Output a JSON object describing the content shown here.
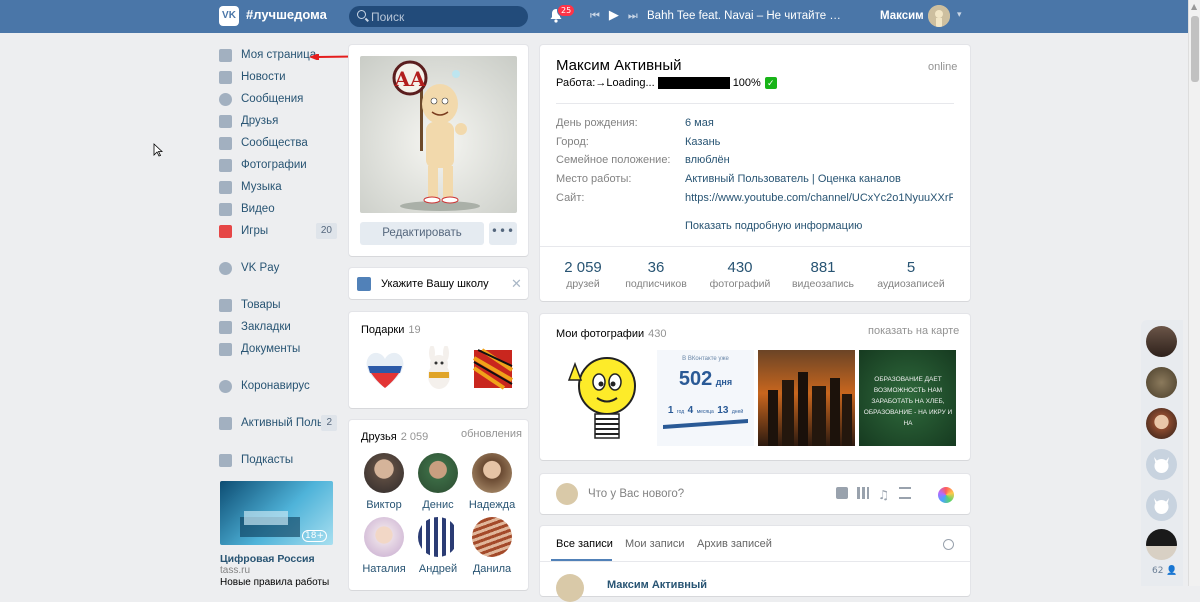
{
  "topbar": {
    "logo": "VK",
    "hashtag": "#лучшедома",
    "search_placeholder": "Поиск",
    "notif_count": "25",
    "track": "Bahh Tee feat. Navai – Не читайте …",
    "user_name": "Максим"
  },
  "menu": {
    "items": [
      {
        "label": "Моя страница",
        "icon": "home-icon"
      },
      {
        "label": "Новости",
        "icon": "news-icon"
      },
      {
        "label": "Сообщения",
        "icon": "messages-icon"
      },
      {
        "label": "Друзья",
        "icon": "friends-icon"
      },
      {
        "label": "Сообщества",
        "icon": "groups-icon"
      },
      {
        "label": "Фотографии",
        "icon": "camera-icon"
      },
      {
        "label": "Музыка",
        "icon": "music-icon"
      },
      {
        "label": "Видео",
        "icon": "video-icon"
      },
      {
        "label": "Игры",
        "icon": "games-icon",
        "count": "20"
      }
    ],
    "pay": "VK Pay",
    "items2": [
      {
        "label": "Товары",
        "icon": "goods-icon"
      },
      {
        "label": "Закладки",
        "icon": "bookmark-icon"
      },
      {
        "label": "Документы",
        "icon": "documents-icon"
      }
    ],
    "corona": "Коронавирус",
    "group": {
      "label": "Активный Польз...",
      "count": "2"
    },
    "podcasts": "Подкасты"
  },
  "promo": {
    "age": "18+",
    "title": "Цифровая Россия",
    "source": "tass.ru",
    "text": "Новые правила работы"
  },
  "profile_left": {
    "edit_button": "Редактировать",
    "more_button": "•••",
    "school": "Укажите Вашу школу",
    "gifts_title": "Подарки",
    "gifts_count": "19",
    "friends_title": "Друзья",
    "friends_count": "2 059",
    "friends_updates": "обновления",
    "friends": [
      "Виктор",
      "Денис",
      "Надежда",
      "Наталия",
      "Андрей",
      "Данила"
    ]
  },
  "profile": {
    "name": "Максим Активный",
    "online": "online",
    "status_prefix": "Работа:→Loading...",
    "status_suffix": "100%",
    "progress": 1.0,
    "info": [
      {
        "label": "День рождения:",
        "value": "6 мая"
      },
      {
        "label": "Город:",
        "value": "Казань"
      },
      {
        "label": "Семейное положение:",
        "value": "влюблён"
      },
      {
        "label": "Место работы:",
        "value": "Активный Пользователь | Оценка каналов"
      },
      {
        "label": "Сайт:",
        "value": "https://www.youtube.com/channel/UCxYc2o1NyuuXXrRE..."
      }
    ],
    "more_info": "Показать подробную информацию",
    "stats": [
      {
        "n": "2 059",
        "l": "друзей"
      },
      {
        "n": "36",
        "l": "подписчиков"
      },
      {
        "n": "430",
        "l": "фотографий"
      },
      {
        "n": "881",
        "l": "видеозапись"
      },
      {
        "n": "5",
        "l": "аудиозаписей"
      }
    ]
  },
  "photos": {
    "title": "Мои фотографии",
    "count": "430",
    "map_link": "показать на карте",
    "counter_caption": "В ВКонтакте уже",
    "counter_number": "502",
    "counter_unit": "дня",
    "counter_detail": [
      "1",
      "год",
      "4",
      "месяца",
      "13",
      "дней"
    ],
    "quote": "ОБРАЗОВАНИЕ ДАЕТ ВОЗМОЖНОСТЬ НАМ ЗАРАБОТАТЬ НА ХЛЕБ, ОБРАЗОВАНИЕ - НА ИКРУ И НА"
  },
  "post": {
    "placeholder": "Что у Вас нового?"
  },
  "wall": {
    "tabs": [
      "Все записи",
      "Мои записи",
      "Архив записей"
    ],
    "first_author": "Максим Активный"
  },
  "right_float": {
    "count": "62"
  },
  "colors": {
    "topbar": "#4a76a8",
    "link": "#285473",
    "accent": "#5181b8",
    "bg": "#edeef0"
  }
}
